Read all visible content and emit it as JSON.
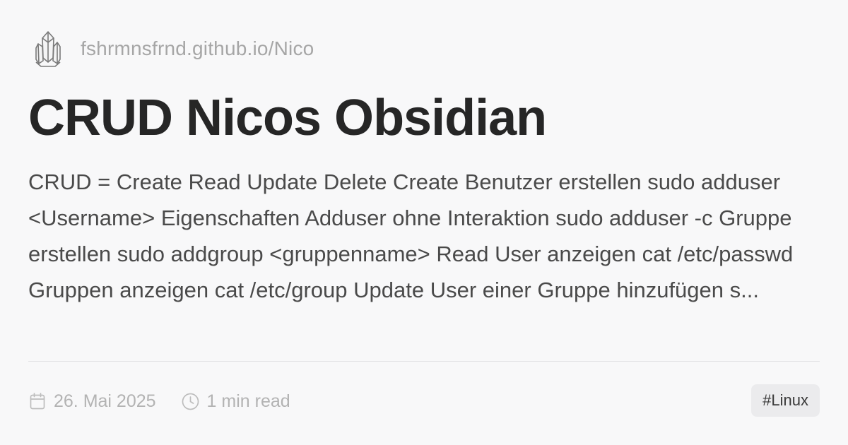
{
  "site": {
    "logo_icon": "crystal-logo-icon",
    "url": "fshrmnsfrnd.github.io/Nico"
  },
  "post": {
    "title": "CRUD Nicos Obsidian",
    "excerpt": "CRUD = Create Read Update Delete Create Benutzer erstellen sudo adduser <Username> Eigenschaften Adduser ohne Interaktion sudo adduser -c Gruppe erstellen sudo addgroup <gruppenname> Read User anzeigen cat /etc/passwd Gruppen anzeigen cat /etc/group Update User einer Gruppe hinzufügen s..."
  },
  "meta": {
    "date_icon": "calendar-icon",
    "date": "26. Mai 2025",
    "reading_icon": "clock-icon",
    "reading_time": "1 min read"
  },
  "tags": [
    "#Linux"
  ],
  "colors": {
    "background": "#f8f8f9",
    "title": "#262626",
    "muted": "#b3b3b3",
    "tag_background": "#ebebed"
  }
}
